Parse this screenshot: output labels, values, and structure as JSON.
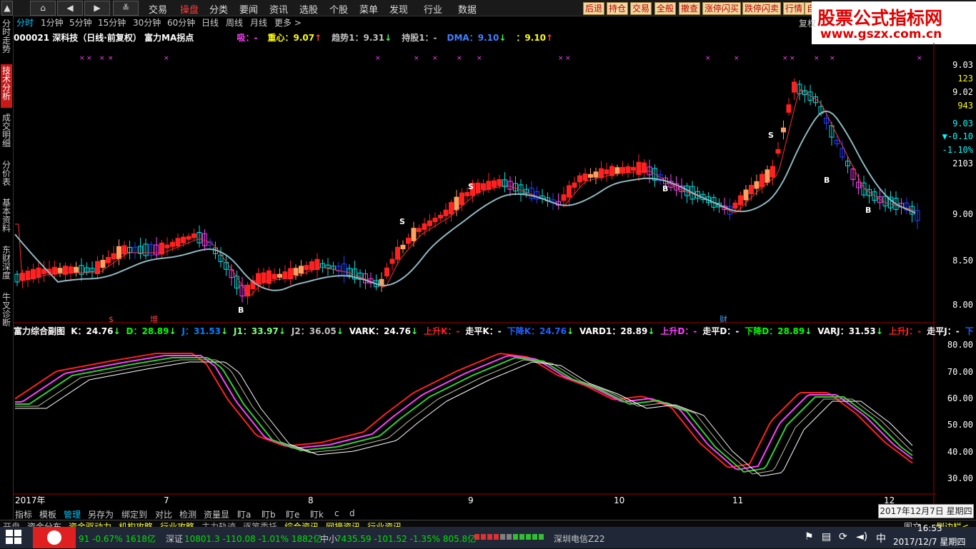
{
  "nav": {
    "home_icon": "home-icon",
    "back_icon": "chevron-left-icon",
    "forward_icon": "chevron-right-icon",
    "more_icon": "double-chevron-down-icon"
  },
  "menu": [
    "交易",
    "操盘",
    "分类",
    "要闻",
    "资讯",
    "选股",
    "个股",
    "菜单",
    "发现",
    "行业",
    "数据"
  ],
  "menu_active": "操盘",
  "quick_buttons": [
    "后退",
    "持仓",
    "交易",
    "全般",
    "撤查",
    "涨停闪买",
    "跌停闪卖",
    "行情",
    "自"
  ],
  "watermark": {
    "title": "股票公式指标网",
    "url": "www.gszx.com.cn"
  },
  "left_tabs": [
    "分时走势",
    "技术分析",
    "成交明细",
    "分价表",
    "基本资料",
    "东财深度",
    "牛叉诊断"
  ],
  "left_tab_active": "技术分析",
  "periods": [
    "分时",
    "1分钟",
    "5分钟",
    "15分钟",
    "30分钟",
    "60分钟",
    "日线",
    "周线",
    "月线",
    "更多 >"
  ],
  "period_active": "分时",
  "top_right_label": "复权",
  "info": {
    "code": "000021",
    "name": "深科技（日线·前复权）",
    "indicator": "富力MA拐点",
    "items": [
      {
        "label": "吸：",
        "value": "-",
        "color": "#ff40ff",
        "arrow": ""
      },
      {
        "label": "重心：",
        "value": "9.07",
        "color": "#ffff00",
        "arrow": "↑"
      },
      {
        "label": "趋势1：",
        "value": "9.31",
        "color": "#c0c0c0",
        "arrow": "↓"
      },
      {
        "label": "持股1：",
        "value": "-",
        "color": "#c0c0c0",
        "arrow": ""
      },
      {
        "label": "DMA：",
        "value": "9.10",
        "color": "#4080ff",
        "arrow": "↓"
      },
      {
        "label": "：",
        "value": "9.10",
        "color": "#ffff00",
        "arrow": "↑"
      }
    ]
  },
  "right_axis": {
    "price_labels": [
      {
        "text": "9.03",
        "color": "#ffffff"
      },
      {
        "text": "123",
        "color": "#ffff00"
      },
      {
        "text": "9.02",
        "color": "#ffffff"
      },
      {
        "text": "943",
        "color": "#ffff00"
      },
      {
        "text": "9.03",
        "color": "#00ffff"
      },
      {
        "text": "▼-0.10",
        "color": "#00ffff"
      },
      {
        "text": "-1.10%",
        "color": "#00ffff"
      },
      {
        "text": "2103",
        "color": "#ffffff"
      }
    ],
    "ticks": [
      "9.00",
      "8.50",
      "8.00"
    ],
    "sub_ticks": [
      "80.00",
      "70.00",
      "60.00",
      "50.00",
      "40.00",
      "30.00"
    ]
  },
  "markers": {
    "S": "S",
    "B": "B",
    "x": "×",
    "sale": "$",
    "zeng": "增",
    "cai": "财"
  },
  "sub": {
    "title": "富力综合副图",
    "items": [
      {
        "label": "K：",
        "value": "24.76",
        "color": "#ffffff",
        "arrow": "↓"
      },
      {
        "label": "D：",
        "value": "28.89",
        "color": "#00ff00",
        "arrow": "↓"
      },
      {
        "label": "J：",
        "value": "31.53",
        "color": "#0080ff",
        "arrow": "↓"
      },
      {
        "label": "J1：",
        "value": "33.97",
        "color": "#80ff80",
        "arrow": "↓"
      },
      {
        "label": "J2：",
        "value": "36.05",
        "color": "#c0c0c0",
        "arrow": "↓"
      },
      {
        "label": "VARK：",
        "value": "24.76",
        "color": "#ffffff",
        "arrow": "↓"
      },
      {
        "label": "上升K：",
        "value": "-",
        "color": "#ff2020",
        "arrow": ""
      },
      {
        "label": "走平K：",
        "value": "-",
        "color": "#ffffff",
        "arrow": ""
      },
      {
        "label": "下降K：",
        "value": "24.76",
        "color": "#2060ff",
        "arrow": "↓"
      },
      {
        "label": "VARD1：",
        "value": "28.89",
        "color": "#ffffff",
        "arrow": "↓"
      },
      {
        "label": "上升D：",
        "value": "-",
        "color": "#ff40ff",
        "arrow": ""
      },
      {
        "label": "走平D：",
        "value": "-",
        "color": "#ffffff",
        "arrow": ""
      },
      {
        "label": "下降D：",
        "value": "28.89",
        "color": "#00ff00",
        "arrow": "↓"
      },
      {
        "label": "VARJ：",
        "value": "31.53",
        "color": "#ffffff",
        "arrow": "↓"
      },
      {
        "label": "上升J：",
        "value": "-",
        "color": "#ff2020",
        "arrow": ""
      },
      {
        "label": "走平J：",
        "value": "-",
        "color": "#ffffff",
        "arrow": ""
      },
      {
        "label": "下",
        "value": "",
        "color": "#2060ff",
        "arrow": ""
      }
    ]
  },
  "xaxis": [
    "2017年",
    "7",
    "8",
    "9",
    "10",
    "11",
    "12"
  ],
  "bottom_tools": [
    "指标",
    "模板",
    "管理",
    "另存为",
    "绑定到",
    "对比",
    "检测",
    "资量显",
    "盯a",
    "盯b",
    "盯e",
    "盯k",
    "c",
    "d"
  ],
  "bottom_active": "管理",
  "date_box": "2017年12月7日 星期四",
  "status": {
    "items": [
      {
        "text": "开盘",
        "color": "#aaaaaa"
      },
      {
        "text": "资金分布",
        "color": "#cccccc"
      },
      {
        "text": "资金驱动力",
        "color": "#ffff40"
      },
      {
        "text": "机构攻略",
        "color": "#ffff40"
      },
      {
        "text": "行业攻略",
        "color": "#ffff40"
      },
      {
        "text": "主力轨迹",
        "color": "#aaaaaa"
      },
      {
        "text": "逐笔委托",
        "color": "#aaaaaa"
      },
      {
        "text": "综合资讯",
        "color": "#ffff40"
      },
      {
        "text": "网摘资讯",
        "color": "#ffff40"
      },
      {
        "text": "行业资讯",
        "color": "#ffff40"
      }
    ],
    "right_label": "图文",
    "side_label": "侧边栏<"
  },
  "taskbar": {
    "index1": "91 -0.67% 1618亿",
    "index2_name": "深证",
    "index2": "10801.3 -110.08 -1.01% 1882亿",
    "index3_name": "中小",
    "index3": "7435.59 -101.52 -1.35% 805.8亿",
    "stock": "深圳电信Z22",
    "ime": "中",
    "time": "16:53",
    "date": "2017/12/7 星期四"
  }
}
